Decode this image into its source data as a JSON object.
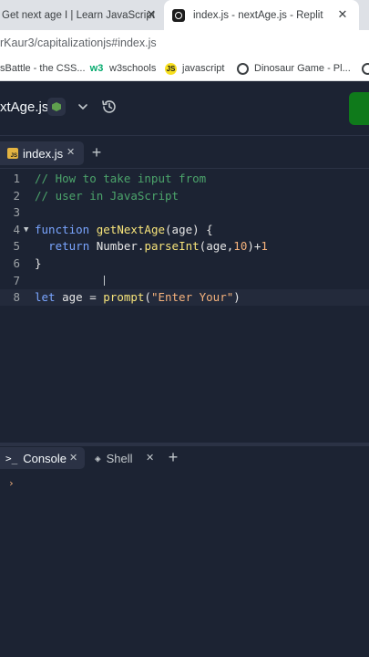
{
  "browser": {
    "tabs": [
      {
        "title": "Get next age I | Learn JavaScript",
        "close": "✕"
      },
      {
        "title": "index.js - nextAge.js - Replit",
        "close": "✕"
      }
    ],
    "url": "rKaur3/capitalizationjs#index.js",
    "bookmarks": [
      {
        "label": "sBattle - the CSS..."
      },
      {
        "label": "w3schools",
        "icon": "w3"
      },
      {
        "label": "javascript",
        "icon": "JS"
      },
      {
        "label": "Dinosaur Game - Pl...",
        "icon": "dino-icon"
      },
      {
        "label": "",
        "icon": "globe-icon"
      }
    ]
  },
  "app": {
    "repl_name": "xtAge.js",
    "language": "nodejs"
  },
  "editor": {
    "file_tab": {
      "name": "index.js",
      "close": "✕",
      "icon": "JS"
    },
    "add_tab": "+",
    "lines": [
      {
        "n": "1",
        "html": "<span class=\"c-com\">// How to take input from</span>"
      },
      {
        "n": "2",
        "html": "<span class=\"c-com\">// user in JavaScript</span>"
      },
      {
        "n": "3",
        "html": ""
      },
      {
        "n": "4",
        "fold": "▼",
        "html": "<span class=\"c-kw\">function</span> <span class=\"c-fn\">getNextAge</span>(<span class=\"c-id\">age</span>) {"
      },
      {
        "n": "5",
        "html": "  <span class=\"c-kw\">return</span> <span class=\"c-id\">Number</span>.<span class=\"c-fn\">parseInt</span>(<span class=\"c-id\">age</span>,<span class=\"c-num\">10</span>)+<span class=\"c-num\">1</span>"
      },
      {
        "n": "6",
        "html": "}"
      },
      {
        "n": "7",
        "html": ""
      },
      {
        "n": "8",
        "active": true,
        "html": "<span class=\"c-kw\">let</span> <span class=\"c-id\">age</span> = <span class=\"c-fn\">prompt</span>(<span class=\"c-str\">\"Enter Your\"</span>)"
      }
    ]
  },
  "console": {
    "tabs": [
      {
        "icon": ">_",
        "label": "Console",
        "close": "✕"
      },
      {
        "icon": "◈",
        "label": "Shell",
        "close": "✕"
      }
    ],
    "add_tab": "+",
    "prompt": "›"
  }
}
